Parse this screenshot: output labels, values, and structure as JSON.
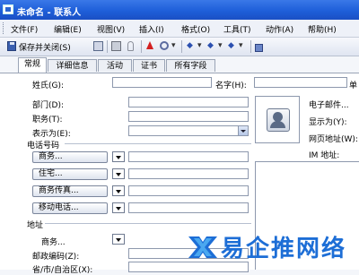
{
  "window": {
    "title": "未命名 - 联系人"
  },
  "menu": [
    "文件(F)",
    "编辑(E)",
    "视图(V)",
    "插入(I)",
    "格式(O)",
    "工具(T)",
    "动作(A)",
    "帮助(H)"
  ],
  "toolbar": {
    "save_close_label": "保存并关闭(S)"
  },
  "tabs": [
    "常规",
    "详细信息",
    "活动",
    "证书",
    "所有字段"
  ],
  "form": {
    "name_label": "姓氏(G):",
    "name_value": "",
    "given_label": "名字(H):",
    "given_trail": "单",
    "dept_label": "部门(D):",
    "title_label": "职务(T):",
    "display_label": "表示为(E):",
    "email_label": "电子邮件...",
    "display_as_label": "显示为(Y):",
    "webpage_label": "网页地址(W):",
    "im_label": "IM 地址:",
    "phone_section": "电话号码",
    "phone_buttons": [
      "商务...",
      "住宅...",
      "商务传真...",
      "移动电话..."
    ],
    "address_section": "地址",
    "address_type": "商务...",
    "zip_label": "邮政编码(Z):",
    "state_label": "省/市/自治区(X):"
  },
  "watermark": {
    "text": "易企推网络"
  }
}
